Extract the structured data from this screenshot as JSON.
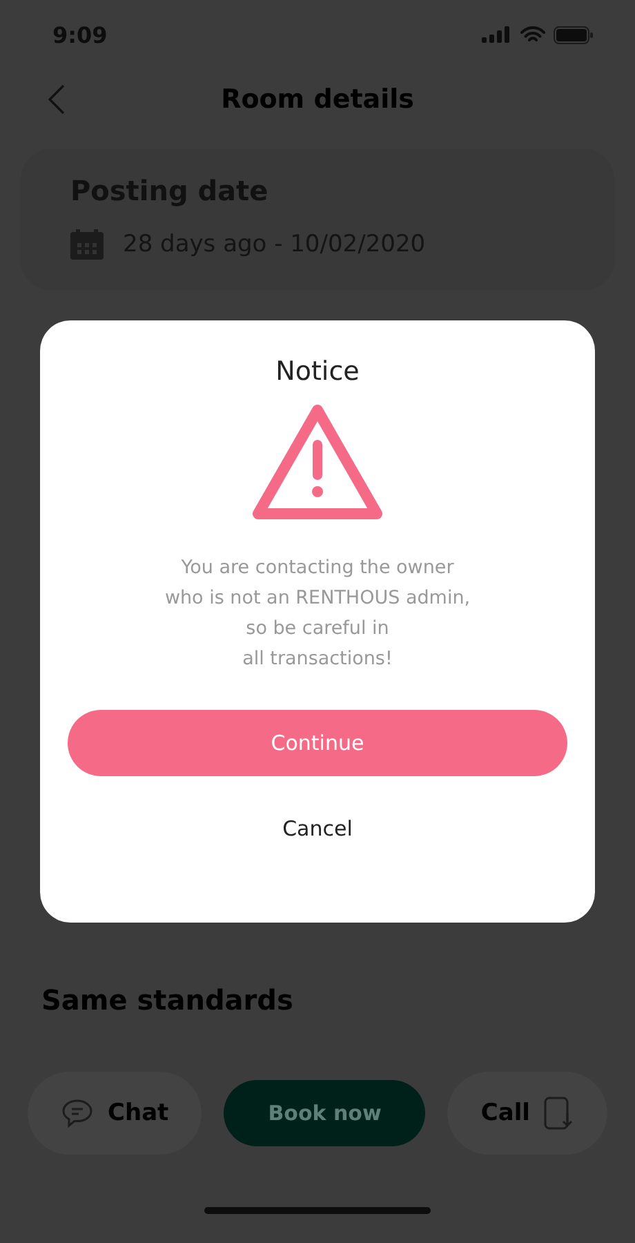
{
  "status_bar": {
    "time": "9:09"
  },
  "header": {
    "title": "Room details"
  },
  "posting_card": {
    "title": "Posting date",
    "date": "28 days ago - 10/02/2020"
  },
  "section_title": "Same standards",
  "bottom_bar": {
    "chat": "Chat",
    "book": "Book now",
    "call": "Call"
  },
  "dialog": {
    "title": "Notice",
    "message": [
      "You are contacting the owner",
      "who is not an RENTHOUS admin,",
      "so be careful in",
      "all transactions!"
    ],
    "buttons": [
      {
        "label": "Continue",
        "kind": "primary"
      },
      {
        "label": "Cancel",
        "kind": "plain"
      }
    ]
  }
}
